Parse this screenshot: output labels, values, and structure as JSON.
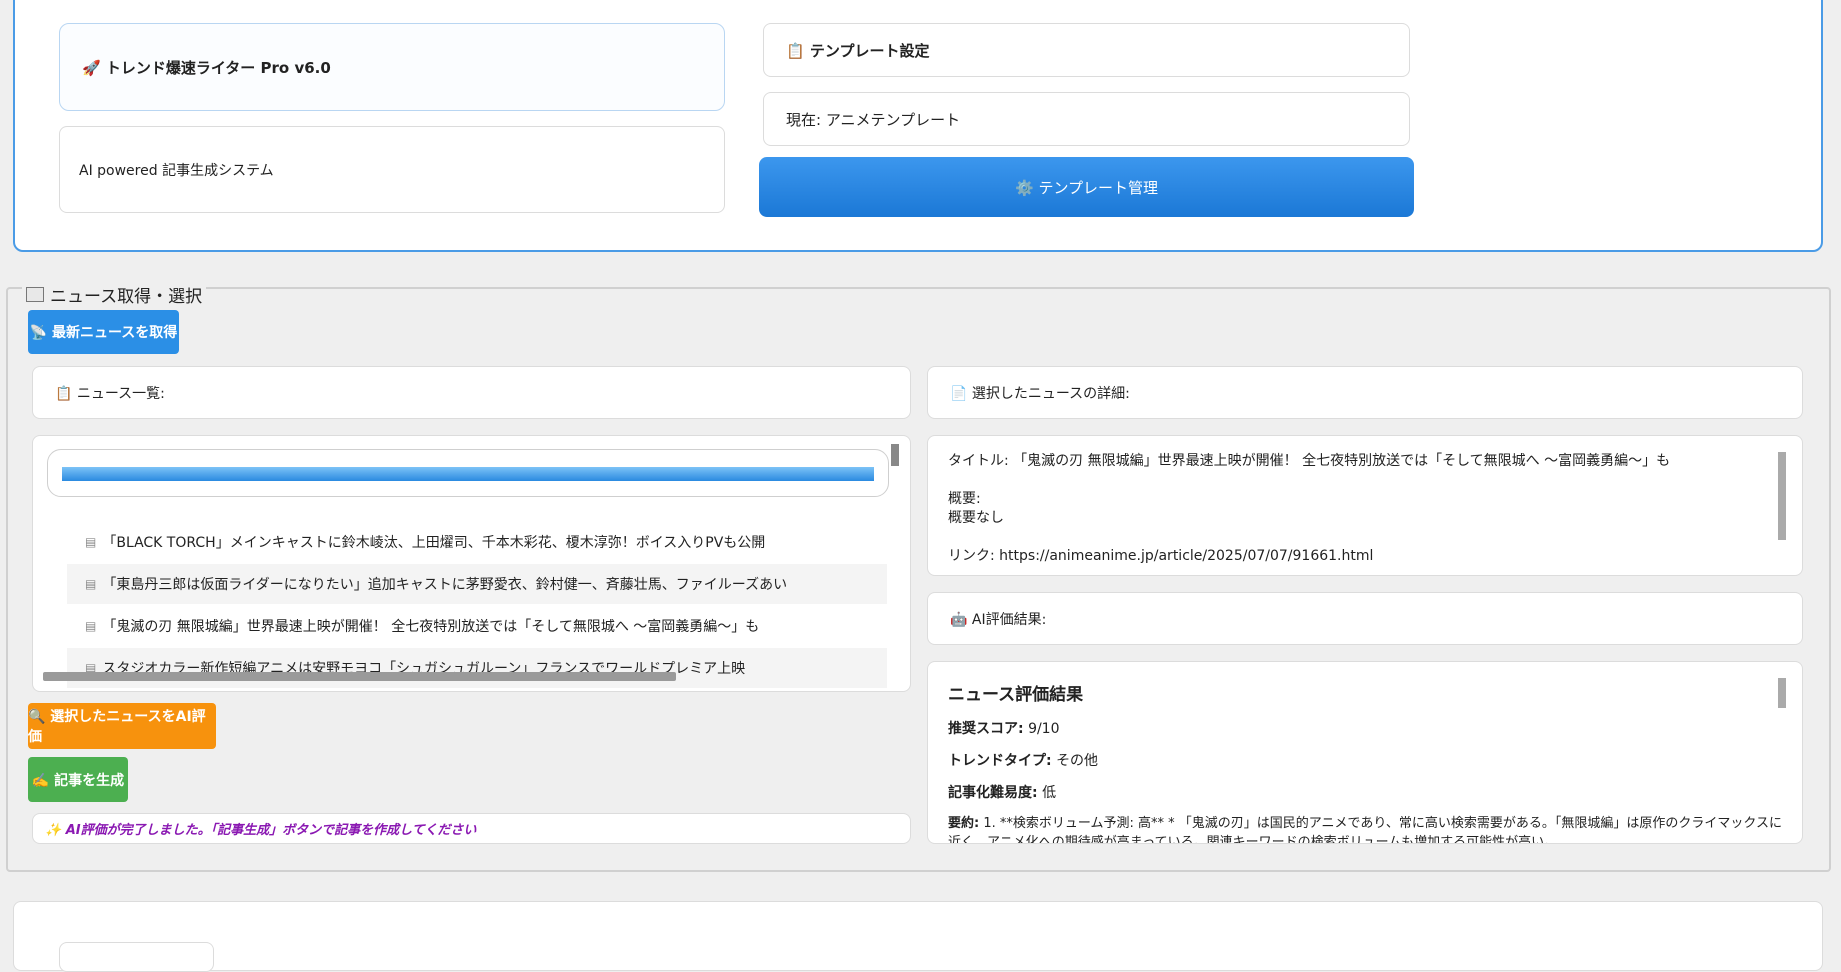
{
  "header": {
    "app_title": "🚀 トレンド爆速ライター Pro v6.0",
    "subtitle": "AI powered 記事生成システム",
    "template_settings": "📋 テンプレート設定",
    "current_template": "現在: アニメテンプレート",
    "template_manage_button": "⚙️ テンプレート管理"
  },
  "news_section": {
    "legend": "ニュース取得・選択",
    "fetch_button": "📡 最新ニュースを取得",
    "list_label": "📋 ニュース一覧:",
    "progress": 1.0,
    "items": [
      "「BLACK TORCH」メインキャストに鈴木崚汰、上田燿司、千本木彩花、榎木淳弥！ボイス入りPVも公開",
      "「東島丹三郎は仮面ライダーになりたい」追加キャストに茅野愛衣、鈴村健一、斉藤壮馬、ファイルーズあい",
      "「鬼滅の刃 無限城編」世界最速上映が開催！ 全七夜特別放送では「そして無限城へ ～富岡義勇編～」も",
      "スタジオカラー新作短編アニメは安野モヨコ「シュガシュガルーン」フランスでワールドプレミア上映"
    ],
    "evaluate_button": "🔍 選択したニュースをAI評価",
    "generate_button": "✍️ 記事を生成",
    "status": "✨ AI評価が完了しました。「記事生成」ボタンで記事を作成してください"
  },
  "detail": {
    "label": "📄 選択したニュースの詳細:",
    "title_line": "タイトル: 「鬼滅の刃 無限城編」世界最速上映が開催！ 全七夜特別放送では「そして無限城へ ～富岡義勇編～」も",
    "summary_label": "概要:",
    "summary_value": "概要なし",
    "link_line": "リンク: https://animeanime.jp/article/2025/07/07/91661.html"
  },
  "ai_result": {
    "label": "🤖 AI評価結果:",
    "heading": "ニュース評価結果",
    "score_label": "推奨スコア:",
    "score_value": "9/10",
    "trend_label": "トレンドタイプ:",
    "trend_value": "その他",
    "difficulty_label": "記事化難易度:",
    "difficulty_value": "低",
    "summary_label": "要約:",
    "summary_value": "1. **検索ボリューム予測: 高** * 「鬼滅の刃」は国民的アニメであり、常に高い検索需要がある。「無限城編」は原作のクライマックスに近く、アニメ化への期待感が高まっている。関連キーワードの検索ボリュームも増加する可能性が高い。"
  },
  "colors": {
    "accent_blue": "#2b8fe6",
    "orange": "#f7920d",
    "green": "#4caf50",
    "status_purple": "#8a18b2"
  }
}
